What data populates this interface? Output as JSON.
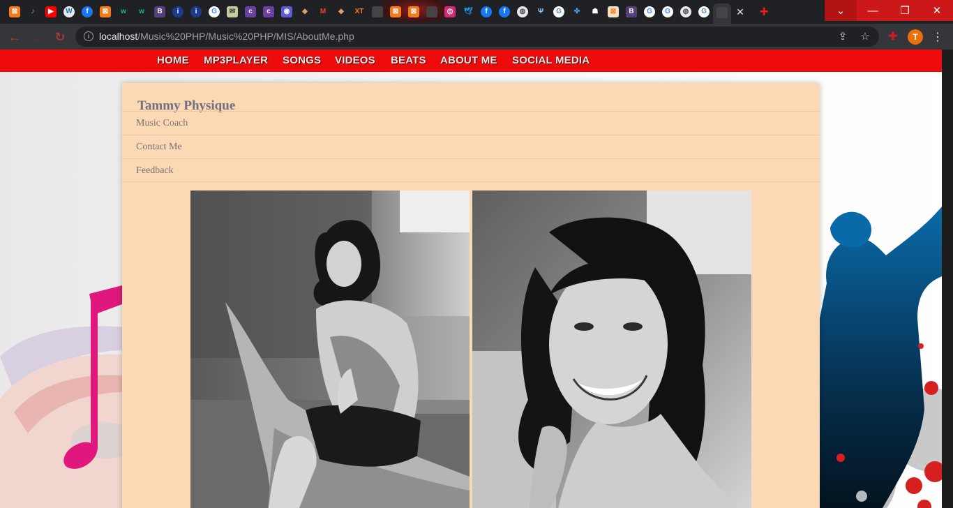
{
  "browser": {
    "tabs": [
      {
        "name": "xampp",
        "glyph": "⊠",
        "bg": "#f57c19",
        "fg": "#ffffff",
        "round": false
      },
      {
        "name": "music",
        "glyph": "♪",
        "bg": "#202124",
        "fg": "#44d36a",
        "round": false
      },
      {
        "name": "youtube",
        "glyph": "▶",
        "bg": "#ff0000",
        "fg": "#ffffff",
        "round": false
      },
      {
        "name": "wordpress",
        "glyph": "W",
        "bg": "#e8eaed",
        "fg": "#21759b",
        "round": true
      },
      {
        "name": "facebook",
        "glyph": "f",
        "bg": "#1877f2",
        "fg": "#ffffff",
        "round": true
      },
      {
        "name": "xampp",
        "glyph": "⊠",
        "bg": "#f57c19",
        "fg": "#ffffff",
        "round": false
      },
      {
        "name": "webnode",
        "glyph": "w",
        "bg": "#202124",
        "fg": "#1dbf73",
        "round": false
      },
      {
        "name": "webnode",
        "glyph": "w",
        "bg": "#202124",
        "fg": "#1dbf73",
        "round": false
      },
      {
        "name": "bootstrap",
        "glyph": "B",
        "bg": "#563d7c",
        "fg": "#ffffff",
        "round": false
      },
      {
        "name": "info",
        "glyph": "i",
        "bg": "#1a3a8c",
        "fg": "#ffffff",
        "round": true
      },
      {
        "name": "info",
        "glyph": "i",
        "bg": "#1a3a8c",
        "fg": "#ffffff",
        "round": true
      },
      {
        "name": "google",
        "glyph": "G",
        "bg": "#ffffff",
        "fg": "#4285f4",
        "round": true
      },
      {
        "name": "mail",
        "glyph": "✉",
        "bg": "#c9c9a0",
        "fg": "#333333",
        "round": false
      },
      {
        "name": "coloris",
        "glyph": "c",
        "bg": "#6b3fa0",
        "fg": "#ffffff",
        "round": false
      },
      {
        "name": "coloris",
        "glyph": "c",
        "bg": "#6b3fa0",
        "fg": "#ffffff",
        "round": false
      },
      {
        "name": "app",
        "glyph": "◉",
        "bg": "#5b5bd6",
        "fg": "#ffffff",
        "round": false
      },
      {
        "name": "tools",
        "glyph": "◆",
        "bg": "#202124",
        "fg": "#e0a060",
        "round": false
      },
      {
        "name": "gmail",
        "glyph": "M",
        "bg": "#202124",
        "fg": "#ea4335",
        "round": false
      },
      {
        "name": "tools",
        "glyph": "◆",
        "bg": "#202124",
        "fg": "#e0a060",
        "round": false
      },
      {
        "name": "xt",
        "glyph": "XT",
        "bg": "#202124",
        "fg": "#ff7a1a",
        "round": false
      },
      {
        "name": "blank",
        "glyph": "",
        "bg": "#444444",
        "fg": "#ffffff",
        "round": false
      },
      {
        "name": "xampp",
        "glyph": "⊠",
        "bg": "#f57c19",
        "fg": "#ffffff",
        "round": false
      },
      {
        "name": "xampp",
        "glyph": "⊠",
        "bg": "#f57c19",
        "fg": "#ffffff",
        "round": false
      },
      {
        "name": "blank",
        "glyph": "",
        "bg": "#444444",
        "fg": "#ffffff",
        "round": false
      },
      {
        "name": "instagram",
        "glyph": "◎",
        "bg": "#d62976",
        "fg": "#ffffff",
        "round": false
      },
      {
        "name": "twitter",
        "glyph": "🕊",
        "bg": "#202124",
        "fg": "#1da1f2",
        "round": false
      },
      {
        "name": "facebook",
        "glyph": "f",
        "bg": "#1877f2",
        "fg": "#ffffff",
        "round": true
      },
      {
        "name": "facebook",
        "glyph": "f",
        "bg": "#1877f2",
        "fg": "#ffffff",
        "round": true
      },
      {
        "name": "globe",
        "glyph": "◍",
        "bg": "#e8eaed",
        "fg": "#555555",
        "round": true
      },
      {
        "name": "app",
        "glyph": "Ψ",
        "bg": "#202124",
        "fg": "#9ad0ff",
        "round": false
      },
      {
        "name": "google",
        "glyph": "G",
        "bg": "#ffffff",
        "fg": "#4285f4",
        "round": true
      },
      {
        "name": "app",
        "glyph": "✜",
        "bg": "#202124",
        "fg": "#4aa3ff",
        "round": false
      },
      {
        "name": "snapchat",
        "glyph": "☗",
        "bg": "#202124",
        "fg": "#ffffff",
        "round": false
      },
      {
        "name": "xampp",
        "glyph": "⊠",
        "bg": "#f3e3c0",
        "fg": "#f57c19",
        "round": false
      },
      {
        "name": "bootstrap",
        "glyph": "B",
        "bg": "#563d7c",
        "fg": "#ffffff",
        "round": false
      },
      {
        "name": "google",
        "glyph": "G",
        "bg": "#ffffff",
        "fg": "#4285f4",
        "round": true
      },
      {
        "name": "google",
        "glyph": "G",
        "bg": "#ffffff",
        "fg": "#4285f4",
        "round": true
      },
      {
        "name": "globe",
        "glyph": "◍",
        "bg": "#e8eaed",
        "fg": "#555555",
        "round": true
      },
      {
        "name": "google",
        "glyph": "G",
        "bg": "#ffffff",
        "fg": "#4285f4",
        "round": true
      },
      {
        "name": "blank",
        "glyph": "",
        "bg": "#444444",
        "fg": "#ffffff",
        "round": false,
        "active": true
      }
    ],
    "url_host": "localhost",
    "url_path": "/Music%20PHP/Music%20PHP/MIS/AboutMe.php",
    "profile_initial": "T"
  },
  "nav": {
    "items": [
      "HOME",
      "MP3PLAYER",
      "SONGS",
      "VIDEOS",
      "BEATS",
      "ABOUT ME",
      "SOCIAL MEDIA"
    ]
  },
  "card": {
    "title": "Tammy Physique",
    "menu": [
      "Music Coach",
      "Contact Me",
      "Feedback"
    ]
  },
  "colors": {
    "nav_bar": "#ef0b0b",
    "card_bg": "#fcd9b5",
    "window_controls": "#cc1818"
  }
}
